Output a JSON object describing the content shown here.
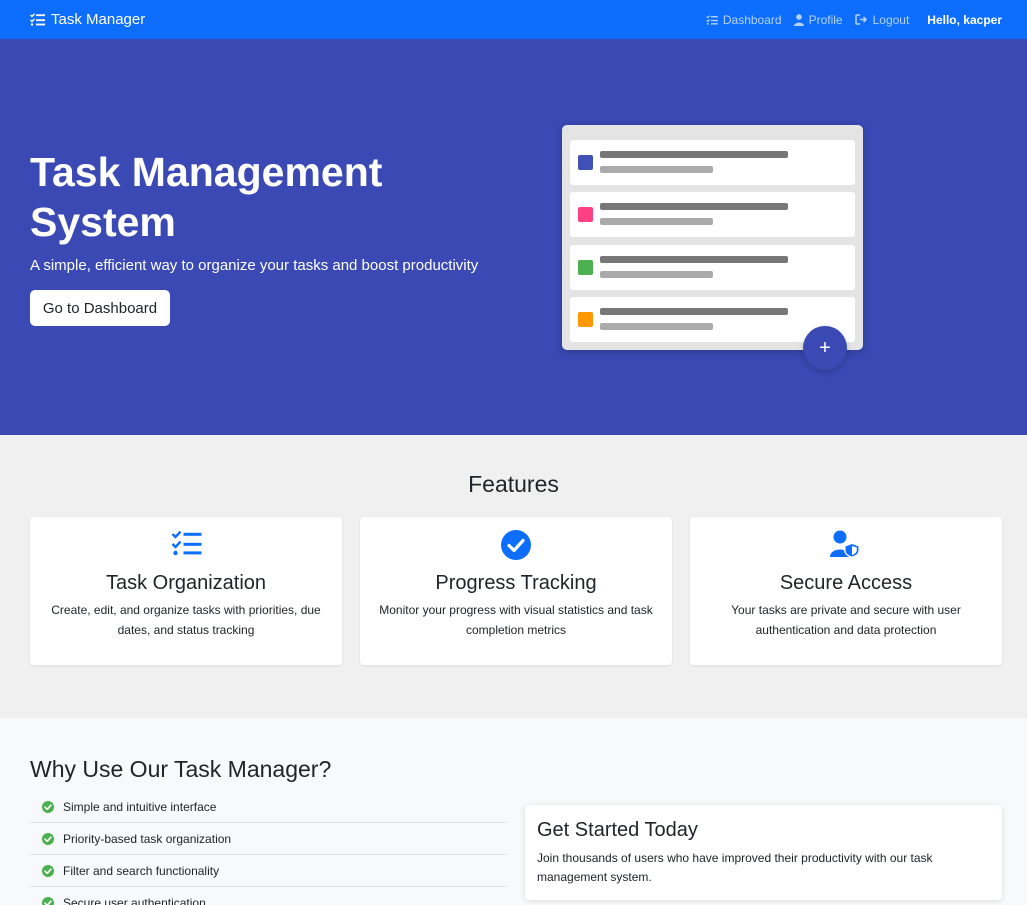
{
  "navbar": {
    "brand": "Task Manager",
    "links": [
      {
        "label": "Dashboard",
        "icon": "list-check-icon"
      },
      {
        "label": "Profile",
        "icon": "user-icon"
      },
      {
        "label": "Logout",
        "icon": "logout-icon"
      }
    ],
    "greeting": "Hello, kacper"
  },
  "hero": {
    "title": "Task Management System",
    "subtitle": "A simple, efficient way to organize your tasks and boost productivity",
    "cta_label": "Go to Dashboard",
    "fab_label": "+",
    "mock_colors": [
      "#3f51b5",
      "#ff4081",
      "#4caf50",
      "#ff9800"
    ]
  },
  "features": {
    "title": "Features",
    "cards": [
      {
        "icon": "list-check-icon",
        "title": "Task Organization",
        "description": "Create, edit, and organize tasks with priorities, due dates, and status tracking"
      },
      {
        "icon": "check-circle-icon",
        "title": "Progress Tracking",
        "description": "Monitor your progress with visual statistics and task completion metrics"
      },
      {
        "icon": "user-shield-icon",
        "title": "Secure Access",
        "description": "Your tasks are private and secure with user authentication and data protection"
      }
    ]
  },
  "why": {
    "title": "Why Use Our Task Manager?",
    "items": [
      "Simple and intuitive interface",
      "Priority-based task organization",
      "Filter and search functionality",
      "Secure user authentication"
    ]
  },
  "get_started": {
    "title": "Get Started Today",
    "description": "Join thousands of users who have improved their productivity with our task management system."
  },
  "colors": {
    "primary": "#0d6efd",
    "hero_bg": "#3a49b3",
    "check_green": "#4caf50"
  }
}
